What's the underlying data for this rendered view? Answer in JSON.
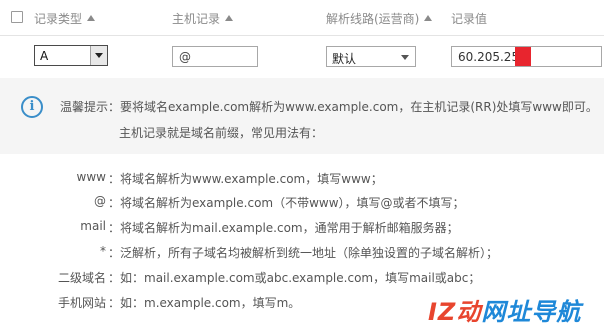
{
  "header": {
    "col_type": "记录类型",
    "col_host": "主机记录",
    "col_line": "解析线路(运营商)",
    "col_value": "记录值"
  },
  "row": {
    "type_value": "A",
    "host_value": "@",
    "line_value": "默认",
    "record_value": "60.205.25."
  },
  "tip": {
    "title_and_text": "温馨提示：要将域名example.com解析为www.example.com，在主机记录(RR)处填写www即可。",
    "text2": "主机记录就是域名前缀，常见用法有："
  },
  "usage": [
    {
      "label": "www",
      "desc": "：将域名解析为www.example.com，填写www；"
    },
    {
      "label": "@",
      "desc": "：将域名解析为example.com（不带www），填写@或者不填写；"
    },
    {
      "label": "mail",
      "desc": "：将域名解析为mail.example.com，通常用于解析邮箱服务器；"
    },
    {
      "label": "*",
      "desc": "：泛解析，所有子域名均被解析到统一地址（除单独设置的子域名解析）；"
    },
    {
      "label": "二级域名",
      "desc": "：如：mail.example.com或abc.example.com，填写mail或abc；"
    },
    {
      "label": "手机网站",
      "desc": "：如：m.example.com，填写m。"
    }
  ],
  "watermark": {
    "part1": "IZ动",
    "part2": "网址导航"
  },
  "colors": {
    "accent": "#3a8ec9",
    "redaction": "#e8252e"
  }
}
